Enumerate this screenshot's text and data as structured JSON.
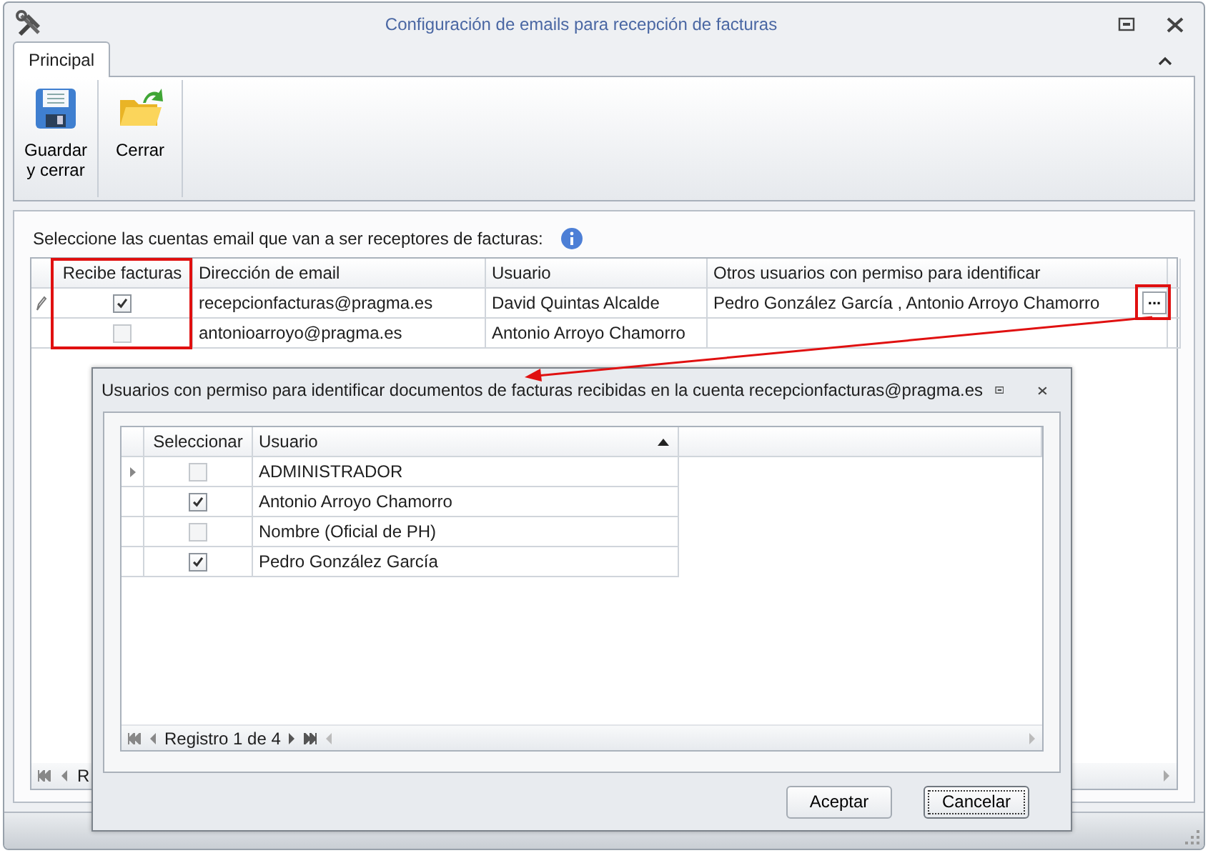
{
  "window": {
    "title": "Configuración de emails para recepción de facturas"
  },
  "tabs": [
    {
      "label": "Principal",
      "selected": true
    }
  ],
  "ribbon_buttons": [
    {
      "kind": "save",
      "label": "Guardar y cerrar"
    },
    {
      "kind": "close",
      "label": "Cerrar"
    }
  ],
  "instruction": "Seleccione las cuentas email que van a ser receptores de facturas:",
  "accounts_table": {
    "columns": [
      "Recibe facturas",
      "Dirección de email",
      "Usuario",
      "Otros usuarios con permiso para identificar"
    ],
    "rows": [
      {
        "editing": true,
        "receives": true,
        "email": "recepcionfacturas@pragma.es",
        "user": "David Quintas Alcalde",
        "others": "Pedro González García , Antonio Arroyo Chamorro",
        "button": "..."
      },
      {
        "editing": false,
        "receives": false,
        "email": "antonioarroyo@pragma.es",
        "user": "Antonio Arroyo Chamorro",
        "others": ""
      }
    ],
    "navigator": "R"
  },
  "dialog": {
    "title": "Usuarios con permiso para identificar documentos de facturas recibidas en la cuenta recepcionfacturas@pragma.es",
    "columns": [
      "Seleccionar",
      "Usuario"
    ],
    "rows": [
      {
        "current": true,
        "selected": false,
        "user": "ADMINISTRADOR"
      },
      {
        "current": false,
        "selected": true,
        "user": "Antonio Arroyo Chamorro"
      },
      {
        "current": false,
        "selected": false,
        "user": "Nombre (Oficial de PH)"
      },
      {
        "current": false,
        "selected": true,
        "user": "Pedro González García"
      }
    ],
    "navigator": "Registro 1 de 4",
    "buttons": [
      {
        "label": "Aceptar",
        "focused": false
      },
      {
        "label": "Cancelar",
        "focused": true
      }
    ]
  }
}
